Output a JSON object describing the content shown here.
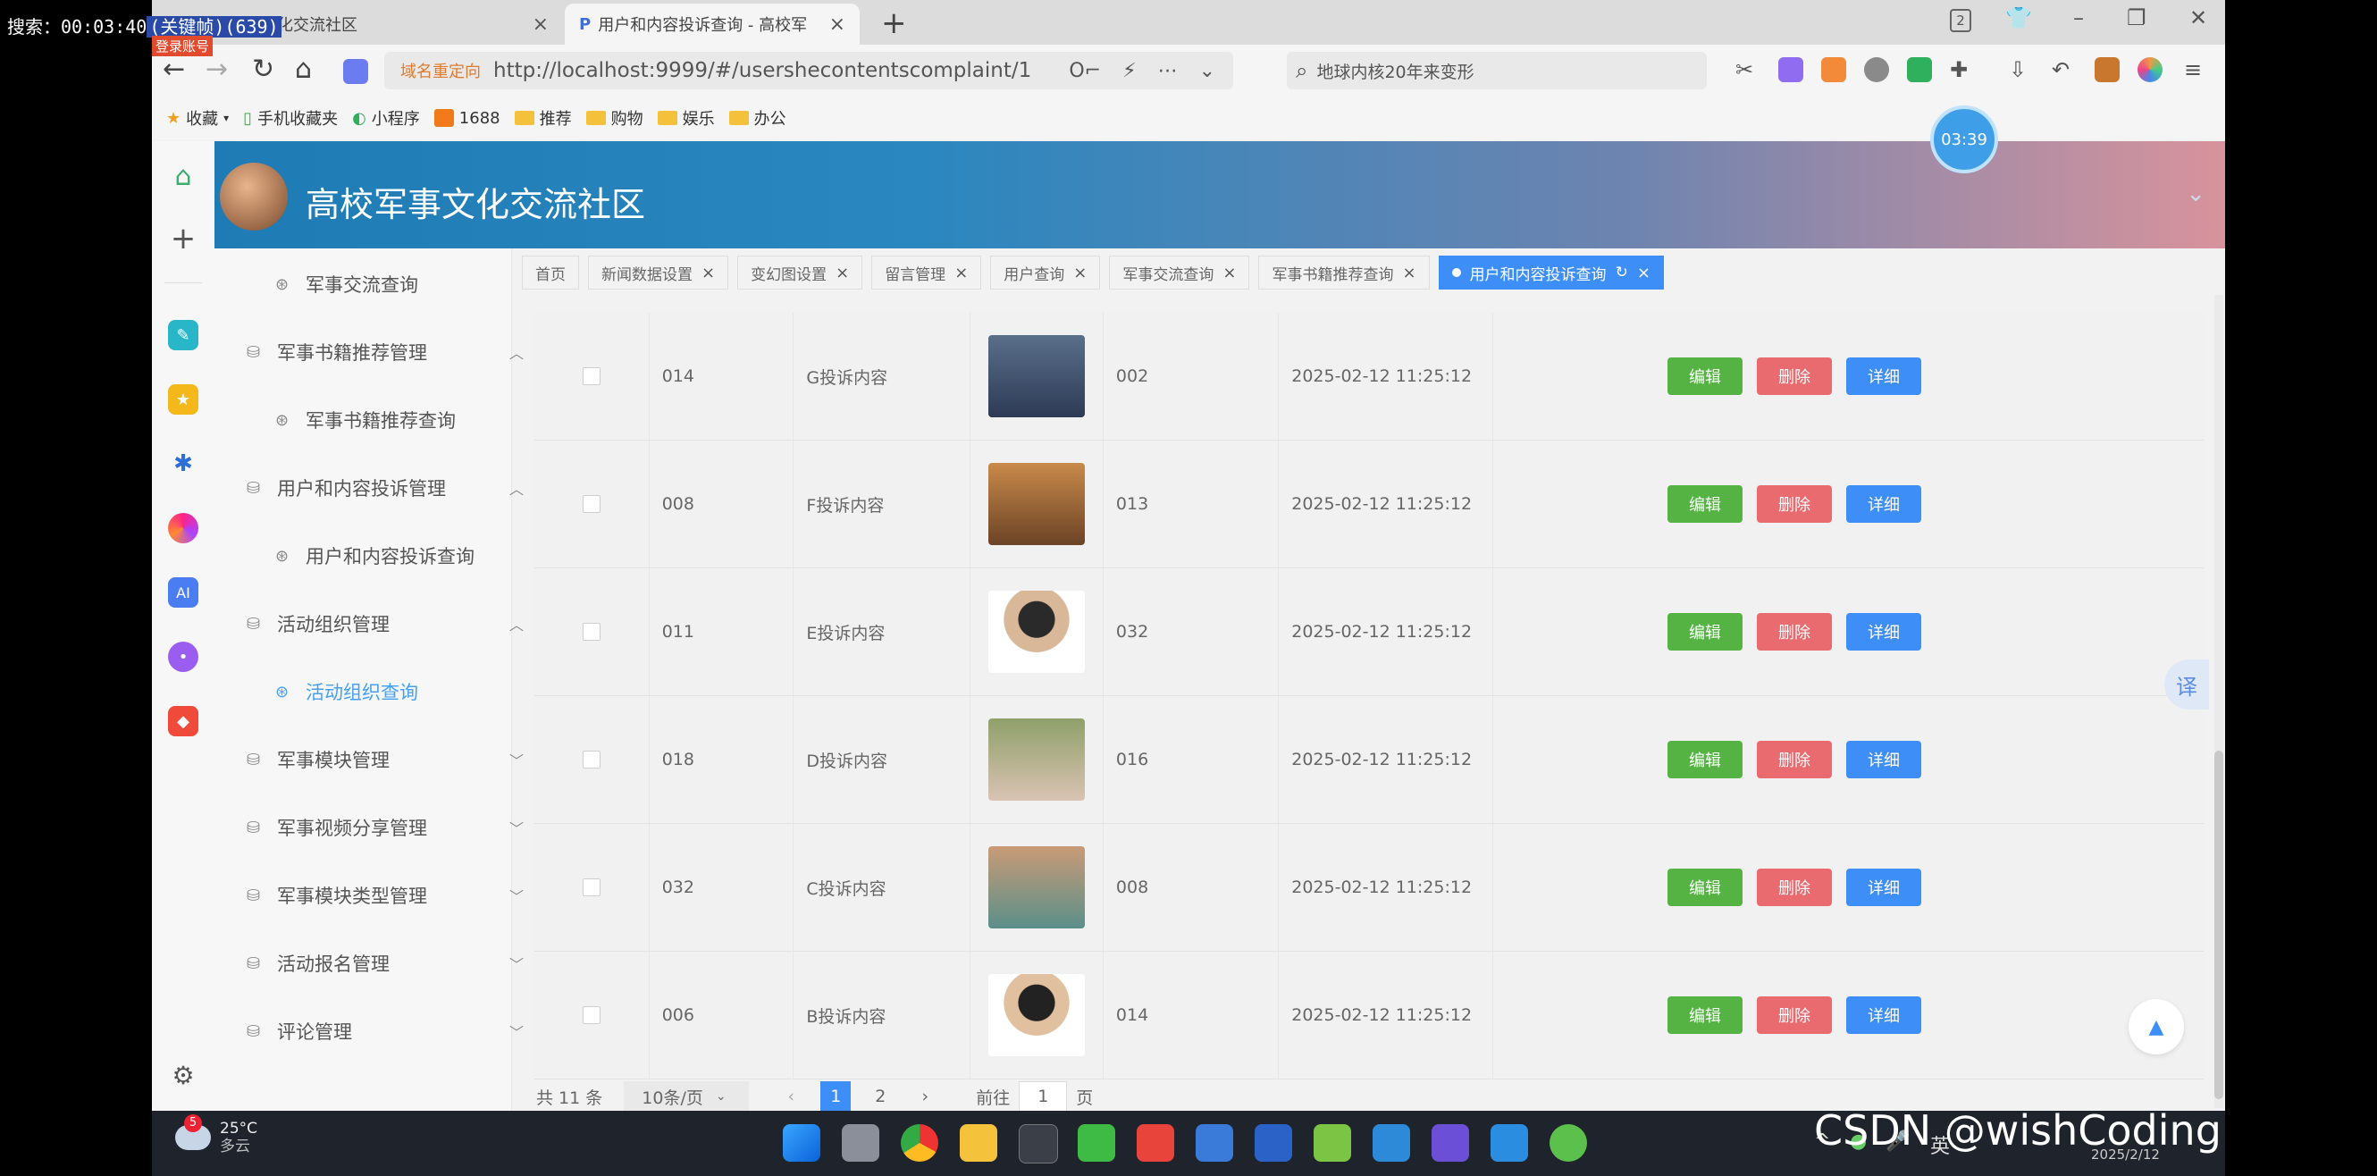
{
  "overlay": {
    "search_label": "搜索：00:03:40",
    "search_tag": "(关键帧)(639)",
    "badge": "登录账号"
  },
  "browser": {
    "tabs": [
      {
        "label": "高校军事文化交流社区"
      },
      {
        "label": "用户和内容投诉查询 - 高校军"
      }
    ],
    "redirect_tag": "域名重定向",
    "url": "http://localhost:9999/#/usershecontentscomplaint/1",
    "search_text": "地球内核20年来变形",
    "tab_count": "2",
    "bookmarks": [
      {
        "label": "收藏"
      },
      {
        "label": "手机收藏夹"
      },
      {
        "label": "小程序"
      },
      {
        "label": "1688"
      },
      {
        "label": "推荐"
      },
      {
        "label": "购物"
      },
      {
        "label": "娱乐"
      },
      {
        "label": "办公"
      }
    ]
  },
  "app": {
    "title": "高校军事文化交流社区",
    "timer": "03:39"
  },
  "sidebar": {
    "items": [
      {
        "label": "军事交流查询",
        "type": "sub"
      },
      {
        "label": "军事书籍推荐管理",
        "type": "group",
        "chev": "^"
      },
      {
        "label": "军事书籍推荐查询",
        "type": "sub"
      },
      {
        "label": "用户和内容投诉管理",
        "type": "group",
        "chev": "^"
      },
      {
        "label": "用户和内容投诉查询",
        "type": "sub"
      },
      {
        "label": "活动组织管理",
        "type": "group",
        "chev": "^"
      },
      {
        "label": "活动组织查询",
        "type": "sub",
        "active": true
      },
      {
        "label": "军事模块管理",
        "type": "group",
        "chev": "v"
      },
      {
        "label": "军事视频分享管理",
        "type": "group",
        "chev": "v"
      },
      {
        "label": "军事模块类型管理",
        "type": "group",
        "chev": "v"
      },
      {
        "label": "活动报名管理",
        "type": "group",
        "chev": "v"
      },
      {
        "label": "评论管理",
        "type": "group",
        "chev": "v"
      }
    ]
  },
  "tags": [
    {
      "label": "首页",
      "closable": false
    },
    {
      "label": "新闻数据设置",
      "closable": true
    },
    {
      "label": "变幻图设置",
      "closable": true
    },
    {
      "label": "留言管理",
      "closable": true
    },
    {
      "label": "用户查询",
      "closable": true
    },
    {
      "label": "军事交流查询",
      "closable": true
    },
    {
      "label": "军事书籍推荐查询",
      "closable": true
    },
    {
      "label": "用户和内容投诉查询",
      "closable": true,
      "active": true
    }
  ],
  "table": {
    "rows": [
      {
        "id": "014",
        "content": "G投诉内容",
        "user": "002",
        "time": "2025-02-12 11:25:12"
      },
      {
        "id": "008",
        "content": "F投诉内容",
        "user": "013",
        "time": "2025-02-12 11:25:12"
      },
      {
        "id": "011",
        "content": "E投诉内容",
        "user": "032",
        "time": "2025-02-12 11:25:12"
      },
      {
        "id": "018",
        "content": "D投诉内容",
        "user": "016",
        "time": "2025-02-12 11:25:12"
      },
      {
        "id": "032",
        "content": "C投诉内容",
        "user": "008",
        "time": "2025-02-12 11:25:12"
      },
      {
        "id": "006",
        "content": "B投诉内容",
        "user": "014",
        "time": "2025-02-12 11:25:12"
      }
    ],
    "actions": {
      "edit": "编辑",
      "delete": "删除",
      "detail": "详细"
    }
  },
  "pagination": {
    "total": "共 11 条",
    "page_size": "10条/页",
    "pages": [
      "1",
      "2"
    ],
    "current": "1",
    "goto_label": "前往",
    "goto_value": "1",
    "goto_suffix": "页"
  },
  "floating": {
    "translate": "译",
    "back_top": "▲"
  },
  "taskbar": {
    "weather_temp": "25°C",
    "weather_desc": "多云",
    "weather_badge": "5",
    "ime": "英",
    "date": "2025/2/12"
  },
  "watermark": "CSDN @wishCoding",
  "colors": {
    "primary": "#3e8ef7",
    "edit": "#55b344",
    "delete": "#e96a6f",
    "active_menu": "#45a0f2"
  }
}
